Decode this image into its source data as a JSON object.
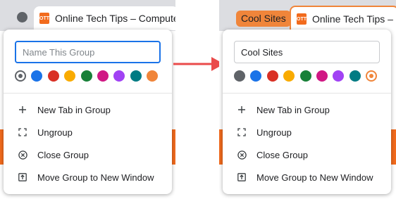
{
  "left": {
    "tab_favicon": "OTT",
    "tab_title": "Online Tech Tips – Computer",
    "name_input": {
      "value": "",
      "placeholder": "Name This Group"
    },
    "menu": [
      {
        "label": "New Tab in Group",
        "icon": "plus-icon"
      },
      {
        "label": "Ungroup",
        "icon": "ungroup-icon"
      },
      {
        "label": "Close Group",
        "icon": "close-circle-icon"
      },
      {
        "label": "Move Group to New Window",
        "icon": "move-window-icon"
      }
    ]
  },
  "right": {
    "group_chip_label": "Cool Sites",
    "tab_favicon": "OTT",
    "tab_title": "Online Tech Tips – C",
    "name_input": {
      "value": "Cool Sites",
      "placeholder": ""
    },
    "menu": [
      {
        "label": "New Tab in Group",
        "icon": "plus-icon"
      },
      {
        "label": "Ungroup",
        "icon": "ungroup-icon"
      },
      {
        "label": "Close Group",
        "icon": "close-circle-icon"
      },
      {
        "label": "Move Group to New Window",
        "icon": "move-window-icon"
      }
    ]
  },
  "colors": {
    "palette": [
      "#5f6368",
      "#1a73e8",
      "#d93025",
      "#f9ab00",
      "#188038",
      "#d01884",
      "#a142f4",
      "#007b83",
      "#f0853a"
    ],
    "left_selected": "#5f6368",
    "right_selected": "#f0853a",
    "arrow": "#ea4b4b"
  }
}
